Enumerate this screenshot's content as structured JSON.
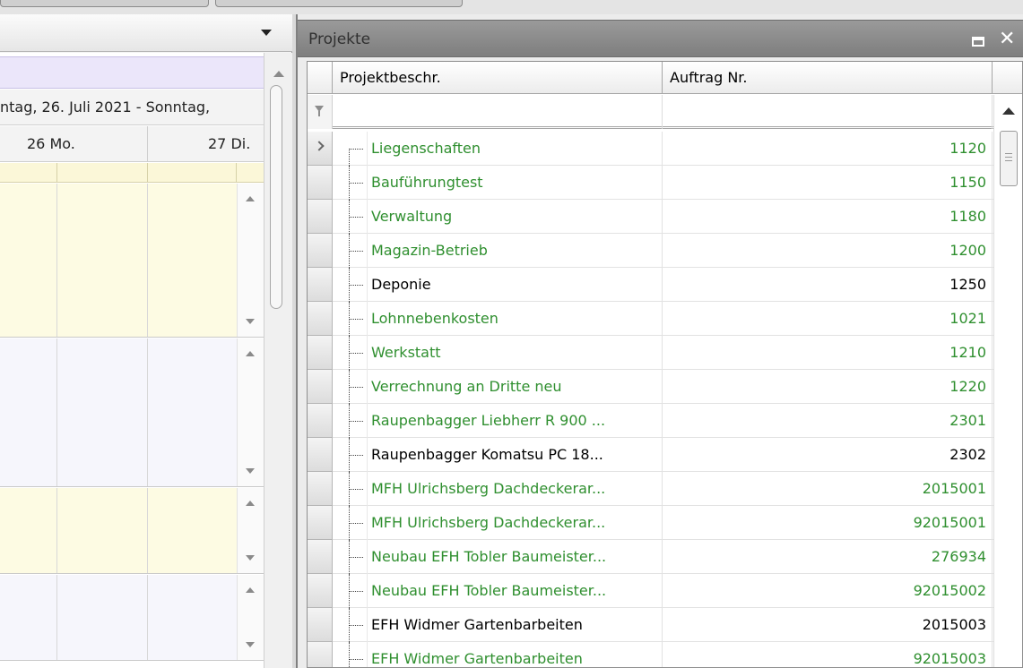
{
  "scheduler": {
    "date_range": "ntag, 26. Juli 2021 - Sonntag,",
    "days": [
      "26 Mo.",
      "27 Di."
    ]
  },
  "panel": {
    "title": "Projekte",
    "maximize_icon": "maximize-icon",
    "close_glyph": "✕"
  },
  "grid": {
    "columns": [
      "Projektbeschr.",
      "Auftrag Nr."
    ],
    "rows": [
      {
        "name": "Liegenschaften",
        "nr": "1120",
        "color": "#2f8f2f"
      },
      {
        "name": "Bauführungtest",
        "nr": "1150",
        "color": "#2f8f2f"
      },
      {
        "name": "Verwaltung",
        "nr": "1180",
        "color": "#2f8f2f"
      },
      {
        "name": "Magazin-Betrieb",
        "nr": "1200",
        "color": "#2f8f2f"
      },
      {
        "name": "Deponie",
        "nr": "1250",
        "color": "#000000"
      },
      {
        "name": "Lohnnebenkosten",
        "nr": "1021",
        "color": "#2f8f2f"
      },
      {
        "name": "Werkstatt",
        "nr": "1210",
        "color": "#2f8f2f"
      },
      {
        "name": "Verrechnung an Dritte neu",
        "nr": "1220",
        "color": "#2f8f2f"
      },
      {
        "name": "Raupenbagger Liebherr R 900 ...",
        "nr": "2301",
        "color": "#2f8f2f"
      },
      {
        "name": "Raupenbagger Komatsu PC 18...",
        "nr": "2302",
        "color": "#000000"
      },
      {
        "name": "MFH Ulrichsberg Dachdeckerar...",
        "nr": "2015001",
        "color": "#2f8f2f"
      },
      {
        "name": "MFH Ulrichsberg Dachdeckerar...",
        "nr": "92015001",
        "color": "#2f8f2f"
      },
      {
        "name": "Neubau EFH Tobler Baumeister...",
        "nr": "276934",
        "color": "#2f8f2f"
      },
      {
        "name": "Neubau EFH Tobler Baumeister...",
        "nr": "92015002",
        "color": "#2f8f2f"
      },
      {
        "name": "EFH Widmer Gartenbarbeiten",
        "nr": "2015003",
        "color": "#000000"
      },
      {
        "name": "EFH Widmer Gartenbarbeiten",
        "nr": "92015003",
        "color": "#2f8f2f"
      }
    ]
  }
}
